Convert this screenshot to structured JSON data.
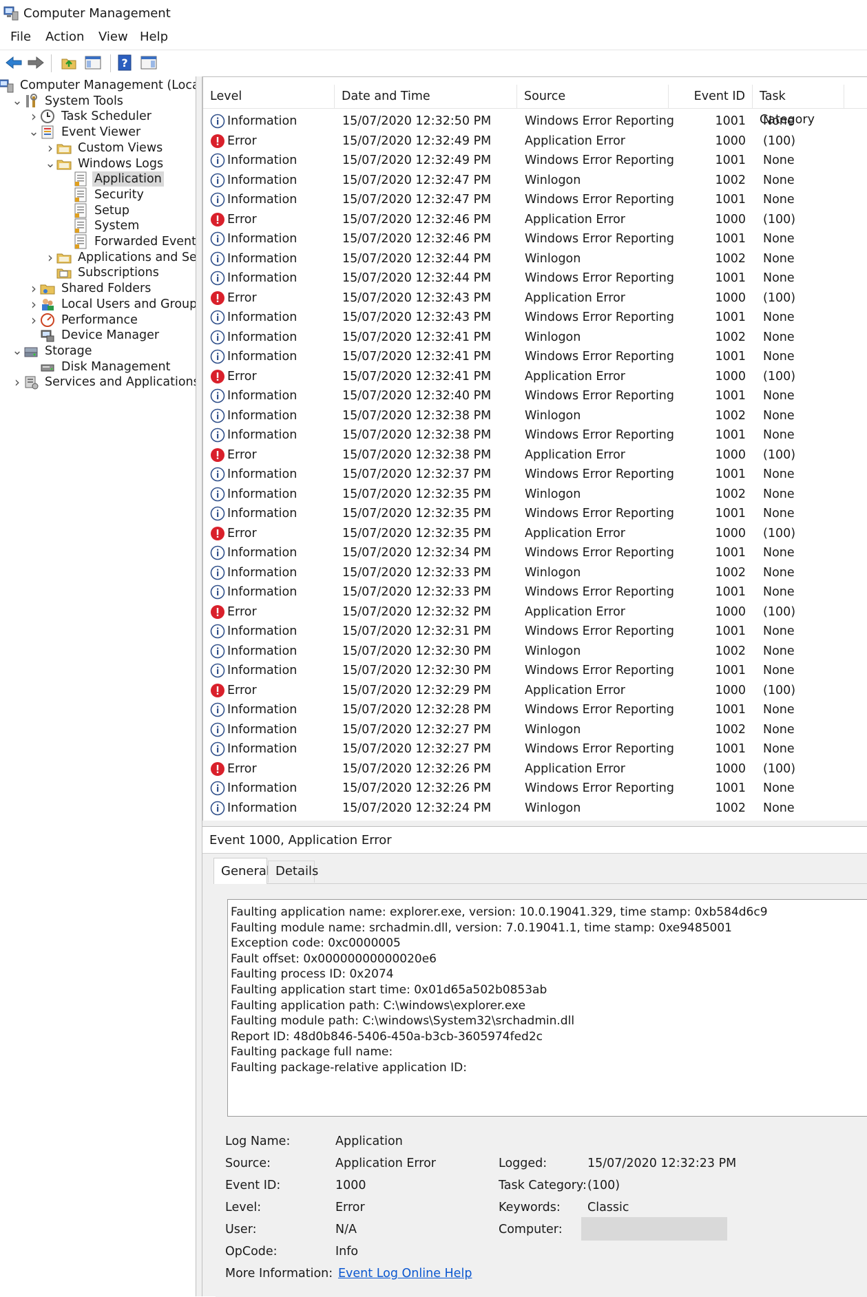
{
  "window": {
    "title": "Computer Management"
  },
  "menu": [
    "File",
    "Action",
    "View",
    "Help"
  ],
  "toolbar": [
    "back-icon",
    "forward-icon",
    "up-folder-icon",
    "show-hide-tree-icon",
    "help-icon",
    "show-hide-action-pane-icon"
  ],
  "tree": [
    {
      "label": "Computer Management (Local",
      "depth": 0,
      "twisty": "",
      "icon": "computer-management-icon"
    },
    {
      "label": "System Tools",
      "depth": 1,
      "twisty": "open",
      "icon": "system-tools-icon"
    },
    {
      "label": "Task Scheduler",
      "depth": 2,
      "twisty": "closed",
      "icon": "clock-icon"
    },
    {
      "label": "Event Viewer",
      "depth": 2,
      "twisty": "open",
      "icon": "event-viewer-icon"
    },
    {
      "label": "Custom Views",
      "depth": 3,
      "twisty": "closed",
      "icon": "folder-icon"
    },
    {
      "label": "Windows Logs",
      "depth": 3,
      "twisty": "open",
      "icon": "folder-icon"
    },
    {
      "label": "Application",
      "depth": 4,
      "twisty": "",
      "icon": "log-icon",
      "selected": true
    },
    {
      "label": "Security",
      "depth": 4,
      "twisty": "",
      "icon": "log-icon"
    },
    {
      "label": "Setup",
      "depth": 4,
      "twisty": "",
      "icon": "log-icon"
    },
    {
      "label": "System",
      "depth": 4,
      "twisty": "",
      "icon": "log-icon"
    },
    {
      "label": "Forwarded Event",
      "depth": 4,
      "twisty": "",
      "icon": "log-icon"
    },
    {
      "label": "Applications and Se",
      "depth": 3,
      "twisty": "closed",
      "icon": "folder-icon"
    },
    {
      "label": "Subscriptions",
      "depth": 3,
      "twisty": "",
      "icon": "subscriptions-icon"
    },
    {
      "label": "Shared Folders",
      "depth": 2,
      "twisty": "closed",
      "icon": "shared-folder-icon"
    },
    {
      "label": "Local Users and Groups",
      "depth": 2,
      "twisty": "closed",
      "icon": "users-icon"
    },
    {
      "label": "Performance",
      "depth": 2,
      "twisty": "closed",
      "icon": "performance-icon"
    },
    {
      "label": "Device Manager",
      "depth": 2,
      "twisty": "",
      "icon": "device-manager-icon"
    },
    {
      "label": "Storage",
      "depth": 1,
      "twisty": "open",
      "icon": "storage-icon"
    },
    {
      "label": "Disk Management",
      "depth": 2,
      "twisty": "",
      "icon": "disk-icon"
    },
    {
      "label": "Services and Applications",
      "depth": 1,
      "twisty": "closed",
      "icon": "services-icon"
    }
  ],
  "columns": [
    "Level",
    "Date and Time",
    "Source",
    "Event ID",
    "Task Category"
  ],
  "events": [
    [
      "Information",
      "15/07/2020 12:32:50 PM",
      "Windows Error Reporting",
      "1001",
      "None"
    ],
    [
      "Error",
      "15/07/2020 12:32:49 PM",
      "Application Error",
      "1000",
      "(100)"
    ],
    [
      "Information",
      "15/07/2020 12:32:49 PM",
      "Windows Error Reporting",
      "1001",
      "None"
    ],
    [
      "Information",
      "15/07/2020 12:32:47 PM",
      "Winlogon",
      "1002",
      "None"
    ],
    [
      "Information",
      "15/07/2020 12:32:47 PM",
      "Windows Error Reporting",
      "1001",
      "None"
    ],
    [
      "Error",
      "15/07/2020 12:32:46 PM",
      "Application Error",
      "1000",
      "(100)"
    ],
    [
      "Information",
      "15/07/2020 12:32:46 PM",
      "Windows Error Reporting",
      "1001",
      "None"
    ],
    [
      "Information",
      "15/07/2020 12:32:44 PM",
      "Winlogon",
      "1002",
      "None"
    ],
    [
      "Information",
      "15/07/2020 12:32:44 PM",
      "Windows Error Reporting",
      "1001",
      "None"
    ],
    [
      "Error",
      "15/07/2020 12:32:43 PM",
      "Application Error",
      "1000",
      "(100)"
    ],
    [
      "Information",
      "15/07/2020 12:32:43 PM",
      "Windows Error Reporting",
      "1001",
      "None"
    ],
    [
      "Information",
      "15/07/2020 12:32:41 PM",
      "Winlogon",
      "1002",
      "None"
    ],
    [
      "Information",
      "15/07/2020 12:32:41 PM",
      "Windows Error Reporting",
      "1001",
      "None"
    ],
    [
      "Error",
      "15/07/2020 12:32:41 PM",
      "Application Error",
      "1000",
      "(100)"
    ],
    [
      "Information",
      "15/07/2020 12:32:40 PM",
      "Windows Error Reporting",
      "1001",
      "None"
    ],
    [
      "Information",
      "15/07/2020 12:32:38 PM",
      "Winlogon",
      "1002",
      "None"
    ],
    [
      "Information",
      "15/07/2020 12:32:38 PM",
      "Windows Error Reporting",
      "1001",
      "None"
    ],
    [
      "Error",
      "15/07/2020 12:32:38 PM",
      "Application Error",
      "1000",
      "(100)"
    ],
    [
      "Information",
      "15/07/2020 12:32:37 PM",
      "Windows Error Reporting",
      "1001",
      "None"
    ],
    [
      "Information",
      "15/07/2020 12:32:35 PM",
      "Winlogon",
      "1002",
      "None"
    ],
    [
      "Information",
      "15/07/2020 12:32:35 PM",
      "Windows Error Reporting",
      "1001",
      "None"
    ],
    [
      "Error",
      "15/07/2020 12:32:35 PM",
      "Application Error",
      "1000",
      "(100)"
    ],
    [
      "Information",
      "15/07/2020 12:32:34 PM",
      "Windows Error Reporting",
      "1001",
      "None"
    ],
    [
      "Information",
      "15/07/2020 12:32:33 PM",
      "Winlogon",
      "1002",
      "None"
    ],
    [
      "Information",
      "15/07/2020 12:32:33 PM",
      "Windows Error Reporting",
      "1001",
      "None"
    ],
    [
      "Error",
      "15/07/2020 12:32:32 PM",
      "Application Error",
      "1000",
      "(100)"
    ],
    [
      "Information",
      "15/07/2020 12:32:31 PM",
      "Windows Error Reporting",
      "1001",
      "None"
    ],
    [
      "Information",
      "15/07/2020 12:32:30 PM",
      "Winlogon",
      "1002",
      "None"
    ],
    [
      "Information",
      "15/07/2020 12:32:30 PM",
      "Windows Error Reporting",
      "1001",
      "None"
    ],
    [
      "Error",
      "15/07/2020 12:32:29 PM",
      "Application Error",
      "1000",
      "(100)"
    ],
    [
      "Information",
      "15/07/2020 12:32:28 PM",
      "Windows Error Reporting",
      "1001",
      "None"
    ],
    [
      "Information",
      "15/07/2020 12:32:27 PM",
      "Winlogon",
      "1002",
      "None"
    ],
    [
      "Information",
      "15/07/2020 12:32:27 PM",
      "Windows Error Reporting",
      "1001",
      "None"
    ],
    [
      "Error",
      "15/07/2020 12:32:26 PM",
      "Application Error",
      "1000",
      "(100)"
    ],
    [
      "Information",
      "15/07/2020 12:32:26 PM",
      "Windows Error Reporting",
      "1001",
      "None"
    ],
    [
      "Information",
      "15/07/2020 12:32:24 PM",
      "Winlogon",
      "1002",
      "None"
    ]
  ],
  "detail": {
    "header": "Event 1000, Application Error",
    "tabs": [
      "General",
      "Details"
    ],
    "description": [
      "Faulting application name: explorer.exe, version: 10.0.19041.329, time stamp: 0xb584d6c9",
      "Faulting module name: srchadmin.dll, version: 7.0.19041.1, time stamp: 0xe9485001",
      "Exception code: 0xc0000005",
      "Fault offset: 0x00000000000020e6",
      "Faulting process ID: 0x2074",
      "Faulting application start time: 0x01d65a502b0853ab",
      "Faulting application path: C:\\windows\\explorer.exe",
      "Faulting module path: C:\\windows\\System32\\srchadmin.dll",
      "Report ID: 48d0b846-5406-450a-b3cb-3605974fed2c",
      "Faulting package full name:",
      "Faulting package-relative application ID:"
    ],
    "fields": {
      "log_name_label": "Log Name:",
      "log_name": "Application",
      "source_label": "Source:",
      "source": "Application Error",
      "logged_label": "Logged:",
      "logged": "15/07/2020 12:32:23 PM",
      "event_id_label": "Event ID:",
      "event_id": "1000",
      "task_category_label": "Task Category:",
      "task_category": "(100)",
      "level_label": "Level:",
      "level": "Error",
      "keywords_label": "Keywords:",
      "keywords": "Classic",
      "user_label": "User:",
      "user": "N/A",
      "computer_label": "Computer:",
      "opcode_label": "OpCode:",
      "opcode": "Info",
      "more_info_label": "More Information:",
      "more_info_link": "Event Log Online Help"
    }
  },
  "colors": {
    "error": "#d9202b",
    "info_ring": "#2f4f8a",
    "link": "#0b57d0",
    "selected": "#d9d9d9"
  }
}
